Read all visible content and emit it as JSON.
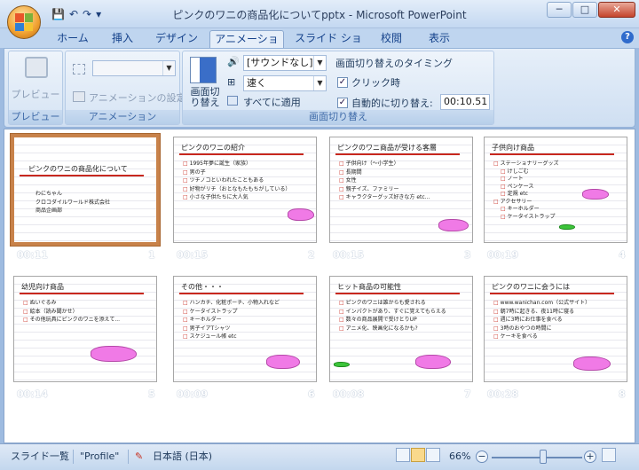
{
  "window": {
    "title": "ピンクのワニの商品化についてpptx - Microsoft PowerPoint",
    "controls": [
      "─",
      "□",
      "✕"
    ]
  },
  "qat": {
    "save": "💾",
    "undo": "↶",
    "redo": "↷",
    "more": "▾"
  },
  "tabs": [
    "ホーム",
    "挿入",
    "デザイン",
    "アニメーション",
    "スライド ショー",
    "校閲",
    "表示"
  ],
  "active_tab": "アニメーション",
  "ribbon": {
    "preview_group": {
      "label": "プレビュー",
      "button": "プレビュー"
    },
    "animation_group": {
      "label": "アニメーション",
      "setting": "アニメーションの設定",
      "combo": ""
    },
    "transition_group": {
      "label": "画面切り替え",
      "button": "画面切り替え",
      "sound": "[サウンドなし]",
      "speed": "速く",
      "apply_all": "すべてに適用"
    },
    "timing": {
      "label": "画面切り替えのタイミング",
      "click": "クリック時",
      "auto": "自動的に切り替え:",
      "auto_time": "00:10.51"
    }
  },
  "slides": [
    {
      "title": "ピンクのワニの商品化について",
      "bullets": [
        "わにちゃん",
        "クロコダイルワールド株式会社",
        "商品企画部"
      ],
      "time": "00:11",
      "num": "1"
    },
    {
      "title": "ピンクのワニの紹介",
      "bullets": [
        "1995年夢に誕生（家族）",
        "男の子",
        "ツチノコといわれたこともある",
        "好物がリチ（おとなもたもちがしている）",
        "小さな子供たちに大人気"
      ],
      "time": "00:15",
      "num": "2"
    },
    {
      "title": "ピンクのワニ商品が受ける客層",
      "bullets": [
        "子供向け（～小学生）",
        "長期間",
        "女性",
        "親子イズ、ファミリー",
        "キャラクターグッズ好きな方 etc..."
      ],
      "time": "00:15",
      "num": "3"
    },
    {
      "title": "子供向け商品",
      "bullets": [
        "ステーショナリーグッズ",
        "けしごむ",
        "ノート",
        "ペンケース",
        "定規 etc",
        "アクセサリー",
        "キーホルダー",
        "ケータイストラップ"
      ],
      "time": "00:19",
      "num": "4"
    },
    {
      "title": "幼児向け商品",
      "bullets": [
        "ぬいぐるみ",
        "絵本（読み聞かせ）",
        "その他玩具にピンクのワニを添えて..."
      ],
      "time": "00:14",
      "num": "5"
    },
    {
      "title": "その他・・・",
      "bullets": [
        "ハンカチ、化粧ポーチ、小物入れなど",
        "ケータイストラップ",
        "キーホルダー",
        "男子イアTシャツ",
        "スケジュール帳 etc"
      ],
      "time": "00:09",
      "num": "6"
    },
    {
      "title": "ヒット商品の可能性",
      "bullets": [
        "ピンクのワニは誰からも愛される",
        "インパクトがあり、すぐに覚えてもらえる",
        "数々の商品展開で受けとりUP",
        "アニメ化、映画化になるかも?"
      ],
      "time": "00:08",
      "num": "7"
    },
    {
      "title": "ピンクのワニに会うには",
      "bullets": [
        "www.wanichan.com（公式サイト）",
        "朝7時に起きる、夜11時に寝る",
        "週に3時にお仕事を食べる",
        "3時のおやつの時間に",
        "ケーキを食べる"
      ],
      "time": "00:28",
      "num": "8"
    }
  ],
  "status": {
    "view": "スライド一覧",
    "theme": "\"Profile\"",
    "lang": "日本語 (日本)",
    "zoom": "66%",
    "minus": "−",
    "plus": "+"
  }
}
